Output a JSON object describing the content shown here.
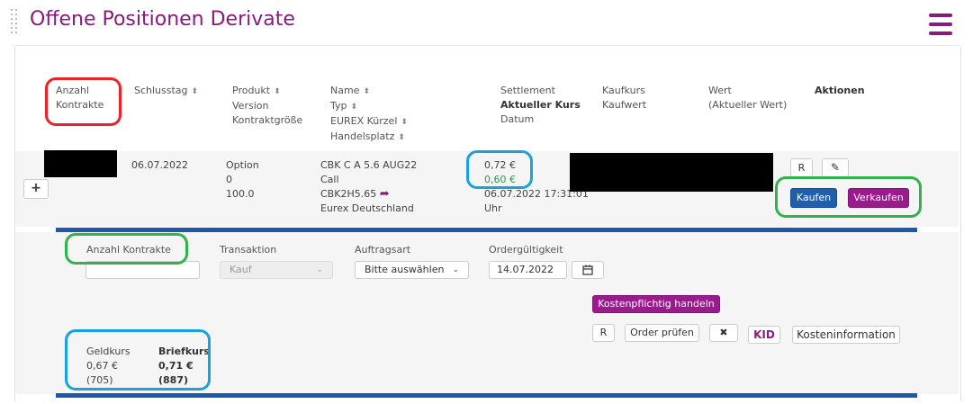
{
  "header": {
    "title": "Offene Positionen Derivate"
  },
  "table": {
    "col_anzahl": [
      "Anzahl",
      "Kontrakte"
    ],
    "col_schlusstag": "Schlusstag",
    "col_produkt": [
      "Produkt",
      "Version",
      "Kontraktgröße"
    ],
    "col_name": [
      "Name",
      "Typ",
      "EUREX Kürzel",
      "Handelsplatz"
    ],
    "col_settlement": [
      "Settlement",
      "Aktueller Kurs",
      "Datum"
    ],
    "col_kaufkurs": [
      "Kaufkurs",
      "Kaufwert"
    ],
    "col_wert": [
      "Wert",
      "(Aktueller Wert)"
    ],
    "col_aktionen": "Aktionen"
  },
  "row": {
    "schlusstag": "06.07.2022",
    "produkt": "Option",
    "version": "0",
    "kontraktgroesse": "100.0",
    "name": "CBK C A 5.6 AUG22",
    "typ": "Call",
    "kuerzel": "CBK2H5.65",
    "handelsplatz": "Eurex Deutschland",
    "settlement": "0,72 €",
    "aktueller_kurs": "0,60 €",
    "datum": "06.07.2022 17:31:01",
    "datum_uhr": "Uhr",
    "btn_r": "R",
    "btn_kaufen": "Kaufen",
    "btn_verkaufen": "Verkaufen",
    "expand_label": "+"
  },
  "order": {
    "anzahl_label": "Anzahl Kontrakte",
    "anzahl_value": "",
    "transaktion_label": "Transaktion",
    "transaktion_value": "Kauf",
    "auftragsart_label": "Auftragsart",
    "auftragsart_value": "Bitte auswählen",
    "gueltigkeit_label": "Ordergültigkeit",
    "gueltigkeit_value": "14.07.2022",
    "kostenpflichtig": "Kostenpflichtig handeln",
    "btn_r": "R",
    "order_pruefen": "Order prüfen",
    "kid": "KID",
    "kosteninformation": "Kosteninformation"
  },
  "quote": {
    "geld_label": "Geldkurs",
    "brief_label": "Briefkurs",
    "geld_value": "0,67 €",
    "brief_value": "0,71 €",
    "geld_size": "(705)",
    "brief_size": "(887)"
  },
  "colors": {
    "brand": "#8a1a7e",
    "blue_button": "#1f5fae",
    "purple_button": "#9b1a8e",
    "positive": "#2e9a4d"
  }
}
